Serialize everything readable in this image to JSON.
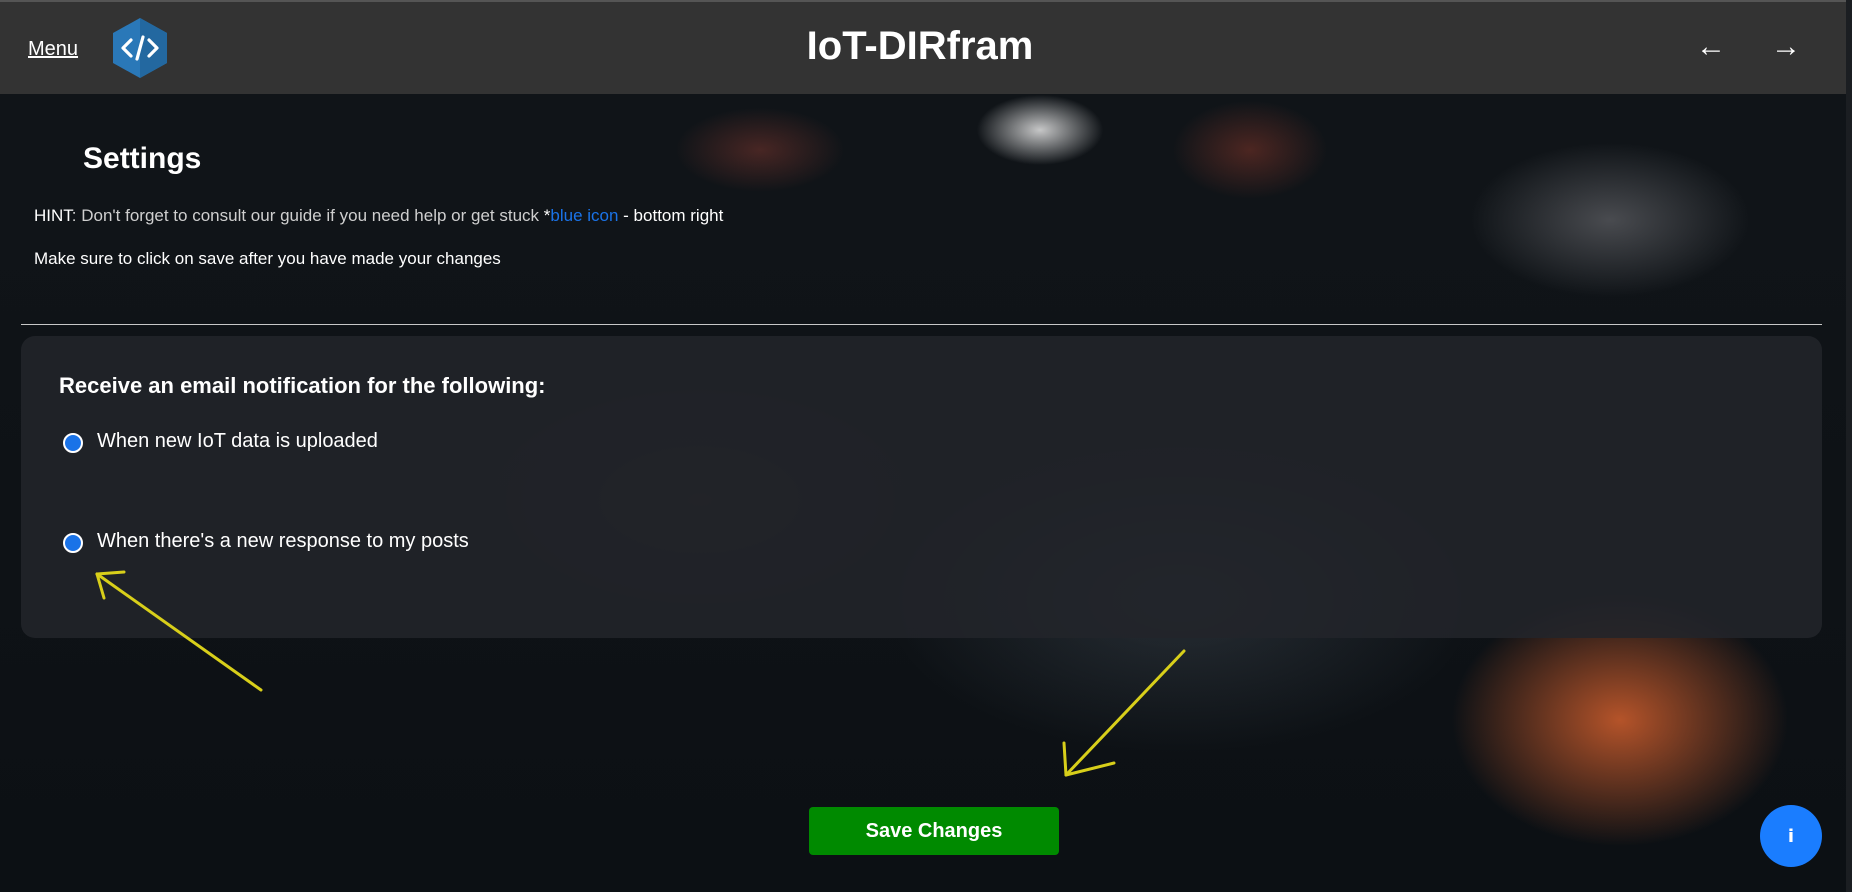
{
  "header": {
    "menu_label": "Menu",
    "logo_icon": "code-brackets-icon",
    "title": "IoT-DIRfram",
    "back_arrow": "←",
    "forward_arrow": "→"
  },
  "settings": {
    "title": "Settings",
    "hint_prefix": "HINT",
    "hint_text": ": Don't forget to consult our guide if you need help or get stuck ",
    "hint_star": "*",
    "hint_link": "blue icon",
    "hint_suffix": " - bottom right",
    "note": "Make sure to click on save after you have made your changes"
  },
  "notifications": {
    "heading": "Receive an email notification for the following:",
    "options": [
      {
        "label": "When new IoT data is uploaded",
        "selected": true
      },
      {
        "label": "When there's a new response to my posts",
        "selected": true
      }
    ]
  },
  "save_button": "Save Changes",
  "info_button": "i",
  "colors": {
    "accent": "#1a73e8",
    "save": "#008a00",
    "topbar": "#333333",
    "annotation": "#d8cf1a"
  }
}
